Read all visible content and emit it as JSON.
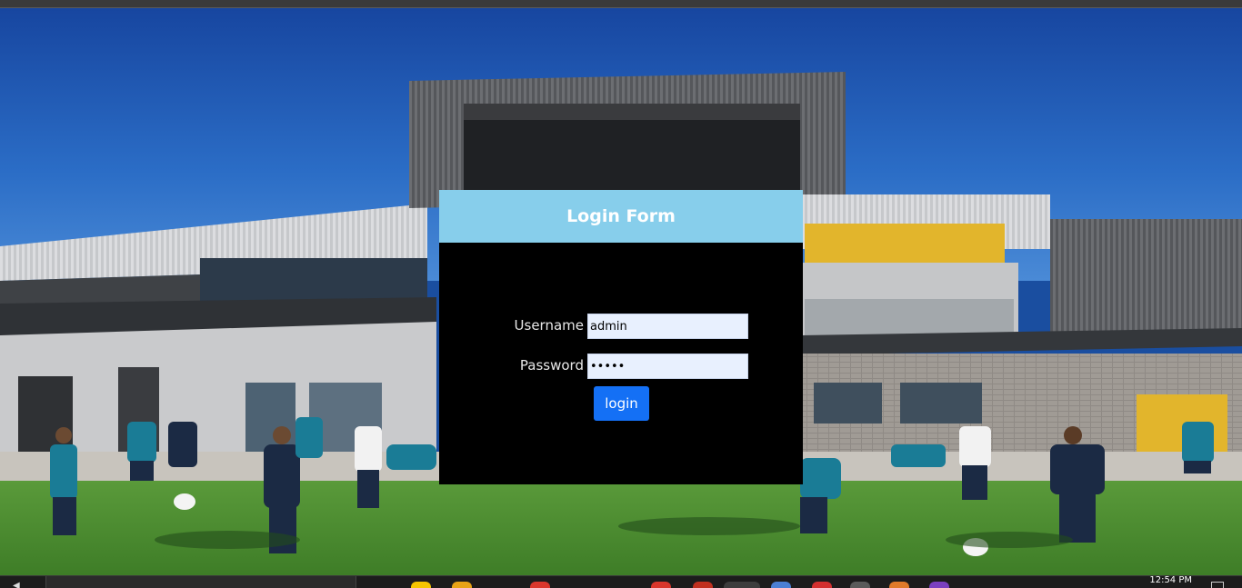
{
  "login_form": {
    "title": "Login Form",
    "username_label": "Username",
    "username_value": "admin",
    "password_label": "Password",
    "password_value": "admin",
    "login_button_label": "login"
  },
  "taskbar": {
    "clock_time": "12:54 PM"
  },
  "colors": {
    "header_bg": "#87ceeb",
    "form_bg": "#000000",
    "button_bg": "#1470f5",
    "input_bg": "#e8f0fe"
  },
  "background": {
    "icon": "school-building-photo"
  }
}
